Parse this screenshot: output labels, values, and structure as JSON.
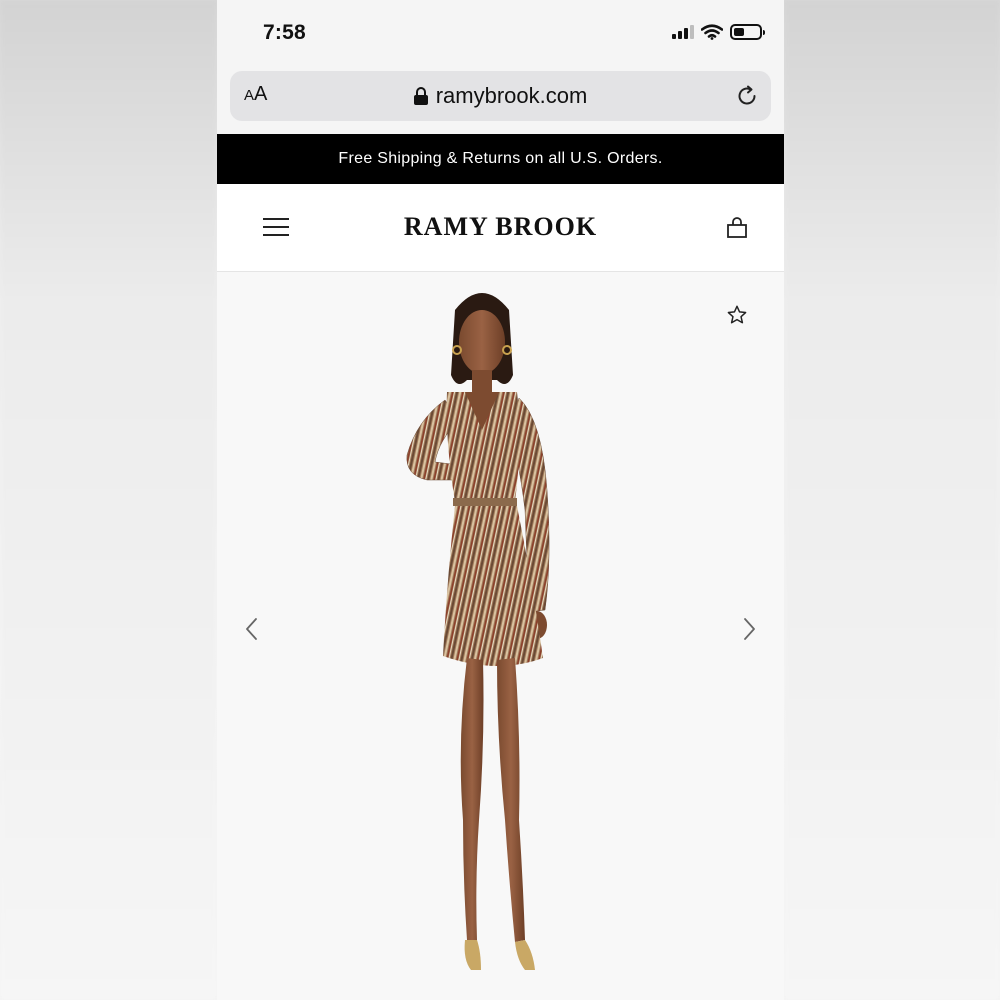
{
  "status_bar": {
    "time": "7:58"
  },
  "browser": {
    "text_size_label_small": "A",
    "text_size_label_large": "A",
    "url": "ramybrook.com"
  },
  "promo_banner": {
    "text": "Free Shipping & Returns on all U.S. Orders."
  },
  "site_header": {
    "logo": "RAMY BROOK"
  },
  "icons": {
    "menu": "hamburger-menu-icon",
    "bag": "shopping-bag-icon",
    "favorite": "star-icon",
    "prev": "chevron-left-icon",
    "next": "chevron-right-icon",
    "lock": "lock-icon",
    "reload": "reload-icon"
  },
  "colors": {
    "banner_bg": "#000000",
    "banner_text": "#ffffff",
    "address_bar_bg": "#e3e3e5"
  }
}
